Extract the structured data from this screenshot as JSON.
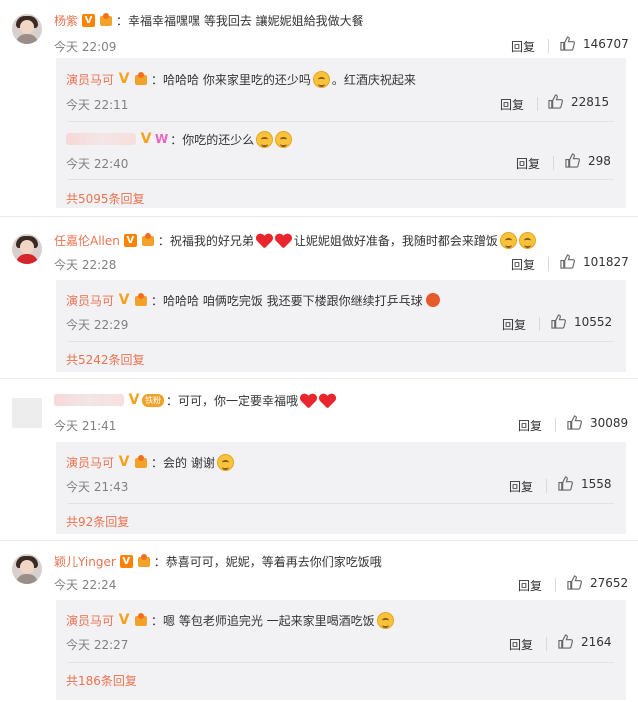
{
  "labels": {
    "reply": "回复"
  },
  "comments": [
    {
      "user": "杨紫",
      "text": "幸福幸福嘿嘿 等我回去 讓妮妮姐給我做大餐",
      "time": "今天 22:09",
      "likes": "146707",
      "replies": [
        {
          "user": "演员马可",
          "text": "哈哈哈 你来家里吃的还少吗",
          "text2": "。红酒庆祝起来",
          "time": "今天 22:11",
          "likes": "22815"
        },
        {
          "user": "",
          "text": "你吃的还少么",
          "time": "今天 22:40",
          "likes": "298"
        }
      ],
      "more": "共5095条回复"
    },
    {
      "user": "任嘉伦Allen",
      "text": "祝福我的好兄弟",
      "text2": "让妮妮姐做好准备，我随时都会来蹭饭",
      "time": "今天 22:28",
      "likes": "101827",
      "replies": [
        {
          "user": "演员马可",
          "text": "哈哈哈 咱俩吃完饭 我还要下楼跟你继续打乒乓球",
          "time": "今天 22:29",
          "likes": "10552"
        }
      ],
      "more": "共5242条回复"
    },
    {
      "user": "",
      "text": "可可，你一定要幸福哦",
      "time": "今天 21:41",
      "likes": "30089",
      "fan_badge": "铁粉",
      "replies": [
        {
          "user": "演员马可",
          "text": "会的 谢谢",
          "time": "今天 21:43",
          "likes": "1558"
        }
      ],
      "more": "共92条回复"
    },
    {
      "user": "颖儿Yinger",
      "text": "恭喜可可，妮妮，等着再去你们家吃饭哦",
      "time": "今天 22:24",
      "likes": "27652",
      "replies": [
        {
          "user": "演员马可",
          "text": "嗯 等包老师追完光 一起来家里喝酒吃饭",
          "time": "今天 22:27",
          "likes": "2164"
        }
      ],
      "more": "共186条回复"
    }
  ],
  "colors": {
    "username": "#eb7350",
    "subbox_bg": "#f2f2f5",
    "time": "#808080"
  },
  "icons": {
    "like": "thumbs-up-icon",
    "verified": "verified-v-icon",
    "vip": "vip-crown-icon"
  }
}
